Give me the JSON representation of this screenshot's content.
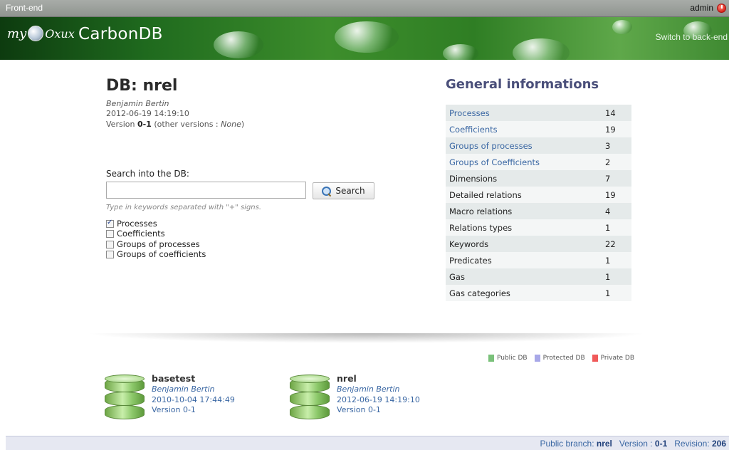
{
  "topbar": {
    "left_label": "Front-end",
    "user": "admin"
  },
  "header": {
    "logo_my": "my",
    "logo_brand": "Oxux",
    "app_title": "CarbonDB",
    "switch_link": "Switch to back-end"
  },
  "db": {
    "title": "DB: nrel",
    "author": "Benjamin Bertin",
    "date": "2012-06-19 14:19:10",
    "version_prefix": "Version ",
    "version": "0-1",
    "other_versions_prefix": " (other versions : ",
    "other_versions": "None",
    "other_versions_suffix": ")"
  },
  "search": {
    "label": "Search into the DB:",
    "value": "",
    "button": "Search",
    "hint": "Type in keywords separated with \"+\" signs.",
    "options": [
      {
        "label": "Processes",
        "checked": true
      },
      {
        "label": "Coefficients",
        "checked": false
      },
      {
        "label": "Groups of processes",
        "checked": false
      },
      {
        "label": "Groups of coefficients",
        "checked": false
      }
    ]
  },
  "general_info": {
    "title": "General informations",
    "rows": [
      {
        "label": "Processes",
        "value": "14",
        "link": true
      },
      {
        "label": "Coefficients",
        "value": "19",
        "link": true
      },
      {
        "label": "Groups of processes",
        "value": "3",
        "link": true
      },
      {
        "label": "Groups of Coefficients",
        "value": "2",
        "link": true
      },
      {
        "label": "Dimensions",
        "value": "7",
        "link": false
      },
      {
        "label": "Detailed relations",
        "value": "19",
        "link": false
      },
      {
        "label": "Macro relations",
        "value": "4",
        "link": false
      },
      {
        "label": "Relations types",
        "value": "1",
        "link": false
      },
      {
        "label": "Keywords",
        "value": "22",
        "link": false
      },
      {
        "label": "Predicates",
        "value": "1",
        "link": false
      },
      {
        "label": "Gas",
        "value": "1",
        "link": false
      },
      {
        "label": "Gas categories",
        "value": "1",
        "link": false
      }
    ]
  },
  "legend": [
    {
      "label": "Public DB",
      "color": "#7ac17a"
    },
    {
      "label": "Protected DB",
      "color": "#a8a8e8"
    },
    {
      "label": "Private DB",
      "color": "#f05a5a"
    }
  ],
  "databases": [
    {
      "name": "basetest",
      "author": "Benjamin Bertin",
      "date": "2010-10-04 17:44:49",
      "version": "Version 0-1"
    },
    {
      "name": "nrel",
      "author": "Benjamin Bertin",
      "date": "2012-06-19 14:19:10",
      "version": "Version 0-1"
    }
  ],
  "footer": {
    "branch_prefix": "Public branch: ",
    "branch": "nrel",
    "version_prefix": "   Version : ",
    "version": "0-1",
    "revision_prefix": "   Revision: ",
    "revision": "206"
  }
}
